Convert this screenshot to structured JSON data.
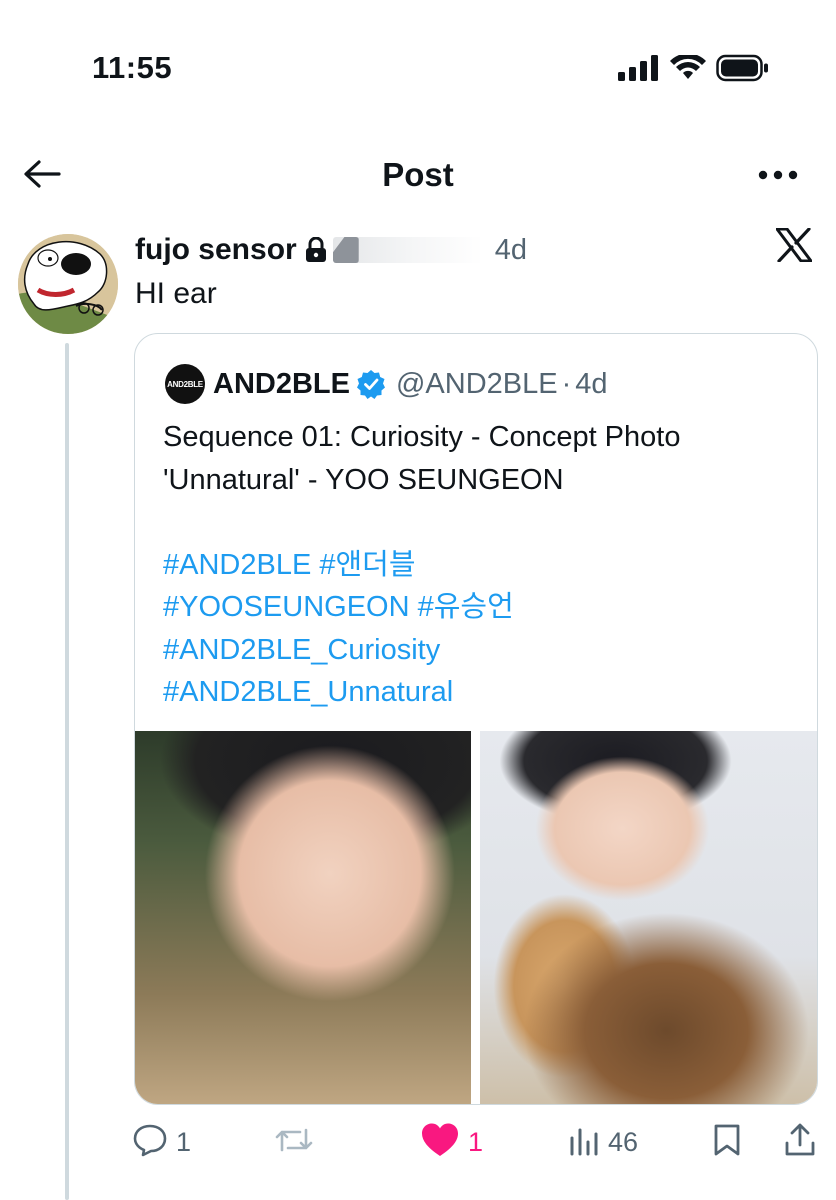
{
  "status_bar": {
    "time": "11:55",
    "icons": [
      "signal-icon",
      "wifi-icon",
      "battery-icon"
    ]
  },
  "header": {
    "title": "Post",
    "back_icon": "arrow-left-icon",
    "more_icon": "more-horizontal-icon"
  },
  "post": {
    "author_name": "fujo sensor",
    "protected_icon": "lock-icon",
    "time": "4d",
    "text": "HI ear",
    "source_icon": "x-logo-icon"
  },
  "quote": {
    "name": "AND2BLE",
    "avatar_text": "AND2BLE",
    "verified_icon": "verified-badge-icon",
    "handle": "@AND2BLE",
    "separator": "·",
    "time": "4d",
    "text_lines": [
      "Sequence 01: Curiosity - Concept Photo",
      "'Unnatural' - YOO SEUNGEON"
    ],
    "hashtags_line1": [
      "#AND2BLE",
      "#앤더블"
    ],
    "hashtags_line2": [
      "#YOOSEUNGEON",
      "#유승언"
    ],
    "hashtags_line3": [
      "#AND2BLE_Curiosity"
    ],
    "hashtags_line4": [
      "#AND2BLE_Unnatural"
    ],
    "photos": 2
  },
  "actions": {
    "replies": "1",
    "reposts": "",
    "likes": "1",
    "views": "46",
    "liked": true
  },
  "colors": {
    "accent": "#1d9bf0",
    "like": "#f91880",
    "muted": "#536471",
    "border": "#cfd9de"
  }
}
